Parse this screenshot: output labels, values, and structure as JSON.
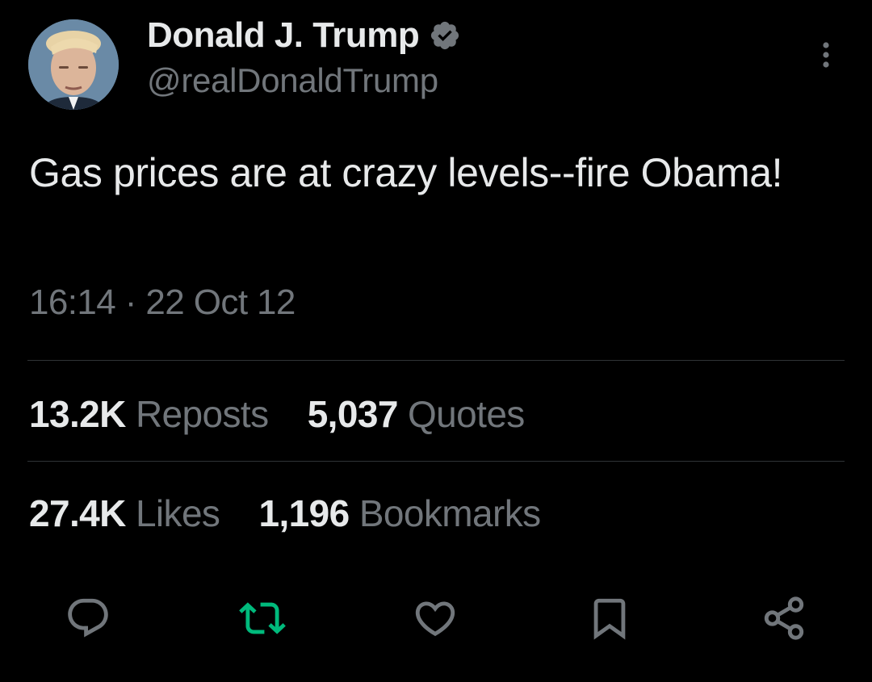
{
  "author": {
    "display_name": "Donald J. Trump",
    "handle": "@realDonaldTrump",
    "verified_icon": "verified-badge-icon",
    "verified_color": "#1d9bf0"
  },
  "tweet": {
    "text": "Gas prices are at crazy levels--fire Obama!",
    "time": "16:14",
    "separator": "·",
    "date": "22 Oct 12"
  },
  "stats": {
    "reposts_count": "13.2K",
    "reposts_label": "Reposts",
    "quotes_count": "5,037",
    "quotes_label": "Quotes",
    "likes_count": "27.4K",
    "likes_label": "Likes",
    "bookmarks_count": "1,196",
    "bookmarks_label": "Bookmarks"
  },
  "actions": {
    "reply_icon": "reply-icon",
    "repost_icon": "repost-icon",
    "like_icon": "heart-icon",
    "bookmark_icon": "bookmark-icon",
    "share_icon": "share-icon",
    "icon_color": "#71767b",
    "repost_color": "#00ba7c"
  },
  "colors": {
    "background": "#000000",
    "text_primary": "#e7e9ea",
    "text_secondary": "#71767b",
    "divider": "#2f3336"
  }
}
